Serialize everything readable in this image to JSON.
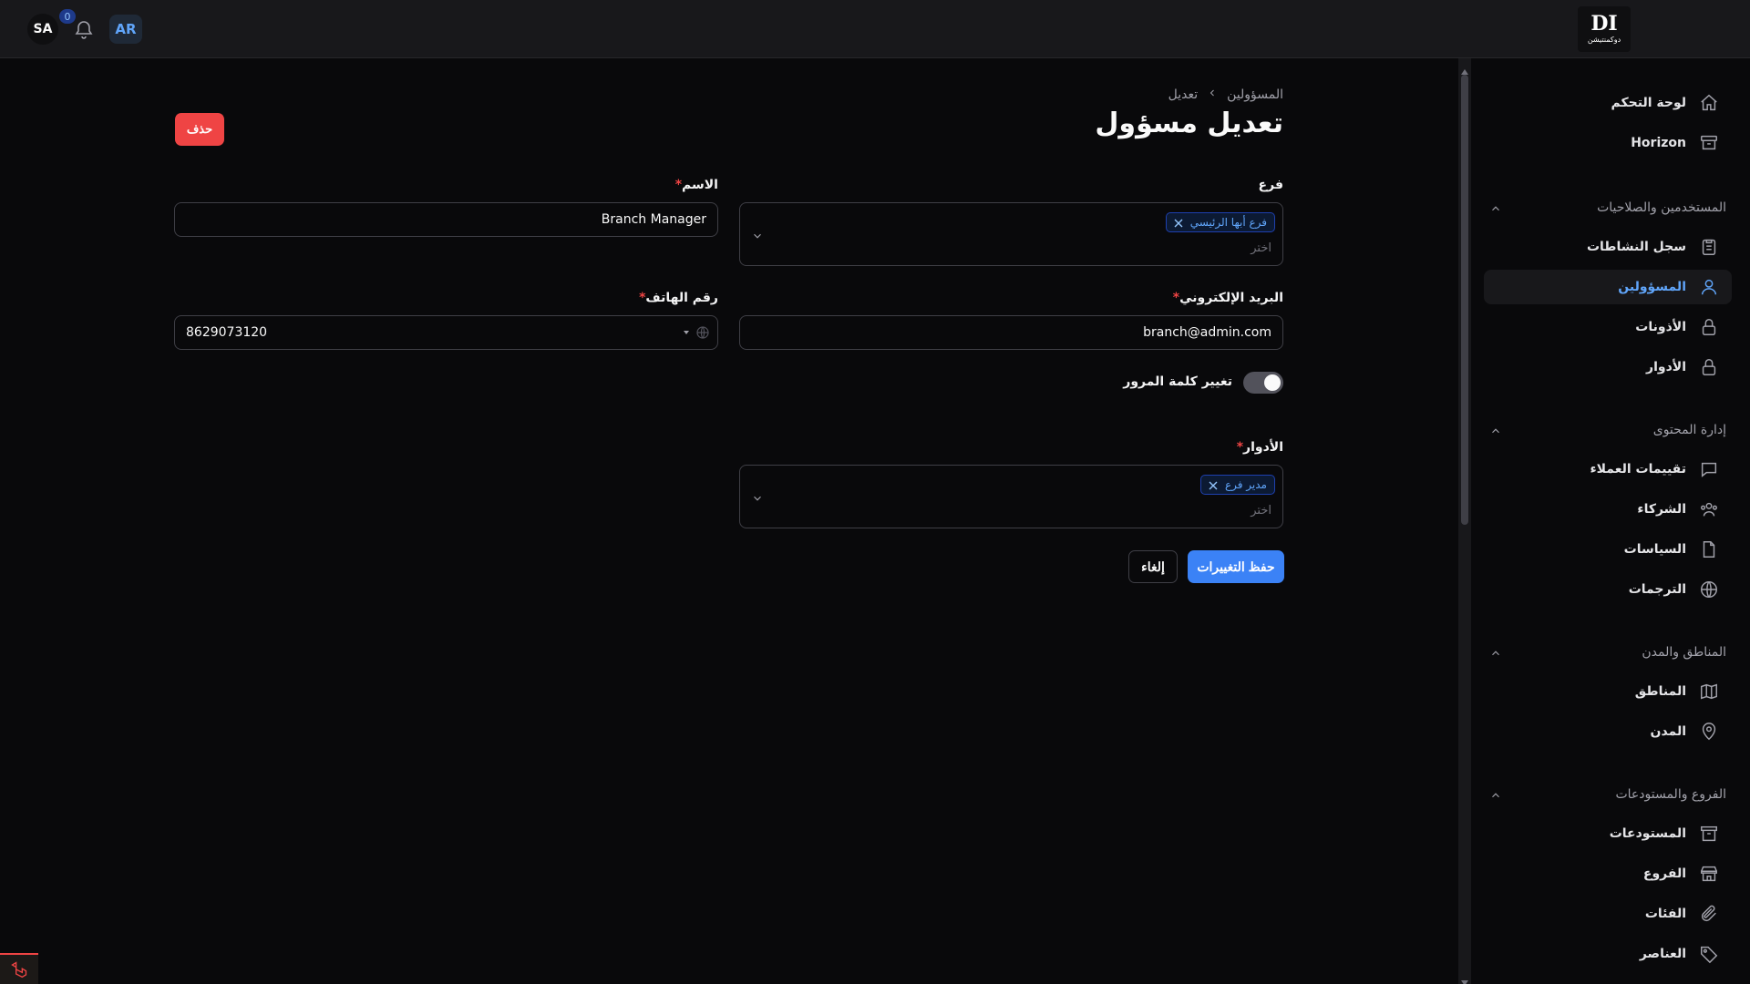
{
  "topbar": {
    "avatar_initials": "SA",
    "notification_count": "0",
    "language_button": "AR",
    "logo_mark": "DI",
    "logo_text": "دوكمنتيشن"
  },
  "sidebar": {
    "top_items": [
      {
        "label": "لوحة التحكم",
        "icon": "home-icon"
      },
      {
        "label": "Horizon",
        "icon": "box-icon"
      }
    ],
    "groups": [
      {
        "label": "المستخدمين والصلاحيات",
        "items": [
          {
            "label": "سجل النشاطات",
            "icon": "clipboard-icon"
          },
          {
            "label": "المسؤولين",
            "icon": "user-icon",
            "active": true
          },
          {
            "label": "الأذونات",
            "icon": "lock-icon"
          },
          {
            "label": "الأدوار",
            "icon": "lock-icon"
          }
        ]
      },
      {
        "label": "إدارة المحتوى",
        "items": [
          {
            "label": "تقييمات العملاء",
            "icon": "chat-icon"
          },
          {
            "label": "الشركاء",
            "icon": "users-icon"
          },
          {
            "label": "السياسات",
            "icon": "document-icon"
          },
          {
            "label": "الترجمات",
            "icon": "globe-icon"
          }
        ]
      },
      {
        "label": "المناطق والمدن",
        "items": [
          {
            "label": "المناطق",
            "icon": "map-icon"
          },
          {
            "label": "المدن",
            "icon": "pin-icon"
          }
        ]
      },
      {
        "label": "الفروع والمستودعات",
        "items": [
          {
            "label": "المستودعات",
            "icon": "archive-icon"
          },
          {
            "label": "الفروع",
            "icon": "store-icon"
          },
          {
            "label": "الفئات",
            "icon": "paperclip-icon"
          },
          {
            "label": "العناصر",
            "icon": "tag-icon"
          }
        ]
      }
    ]
  },
  "breadcrumb": {
    "parent": "المسؤولين",
    "current": "تعديل"
  },
  "page": {
    "title": "تعديل مسؤول",
    "delete_button": "حذف"
  },
  "form": {
    "branch": {
      "label": "فرع",
      "tags": [
        "فرع أبها الرئيسي"
      ],
      "placeholder": "اختر"
    },
    "name": {
      "label": "الاسم",
      "value": "Branch Manager"
    },
    "email": {
      "label": "البريد الإلكتروني",
      "value": "branch@admin.com"
    },
    "phone": {
      "label": "رقم الهاتف",
      "value": "8629073120"
    },
    "change_password": {
      "label": "تغيير كلمة المرور",
      "enabled": true
    },
    "roles": {
      "label": "الأدوار",
      "tags": [
        "مدير فرع"
      ],
      "placeholder": "اختر"
    },
    "required_mark": "*",
    "save_button": "حفظ التغييرات",
    "cancel_button": "إلغاء"
  },
  "colors": {
    "accent": "#3b82f6",
    "danger": "#ef4444",
    "background": "#09090b",
    "surface": "#18181b"
  }
}
